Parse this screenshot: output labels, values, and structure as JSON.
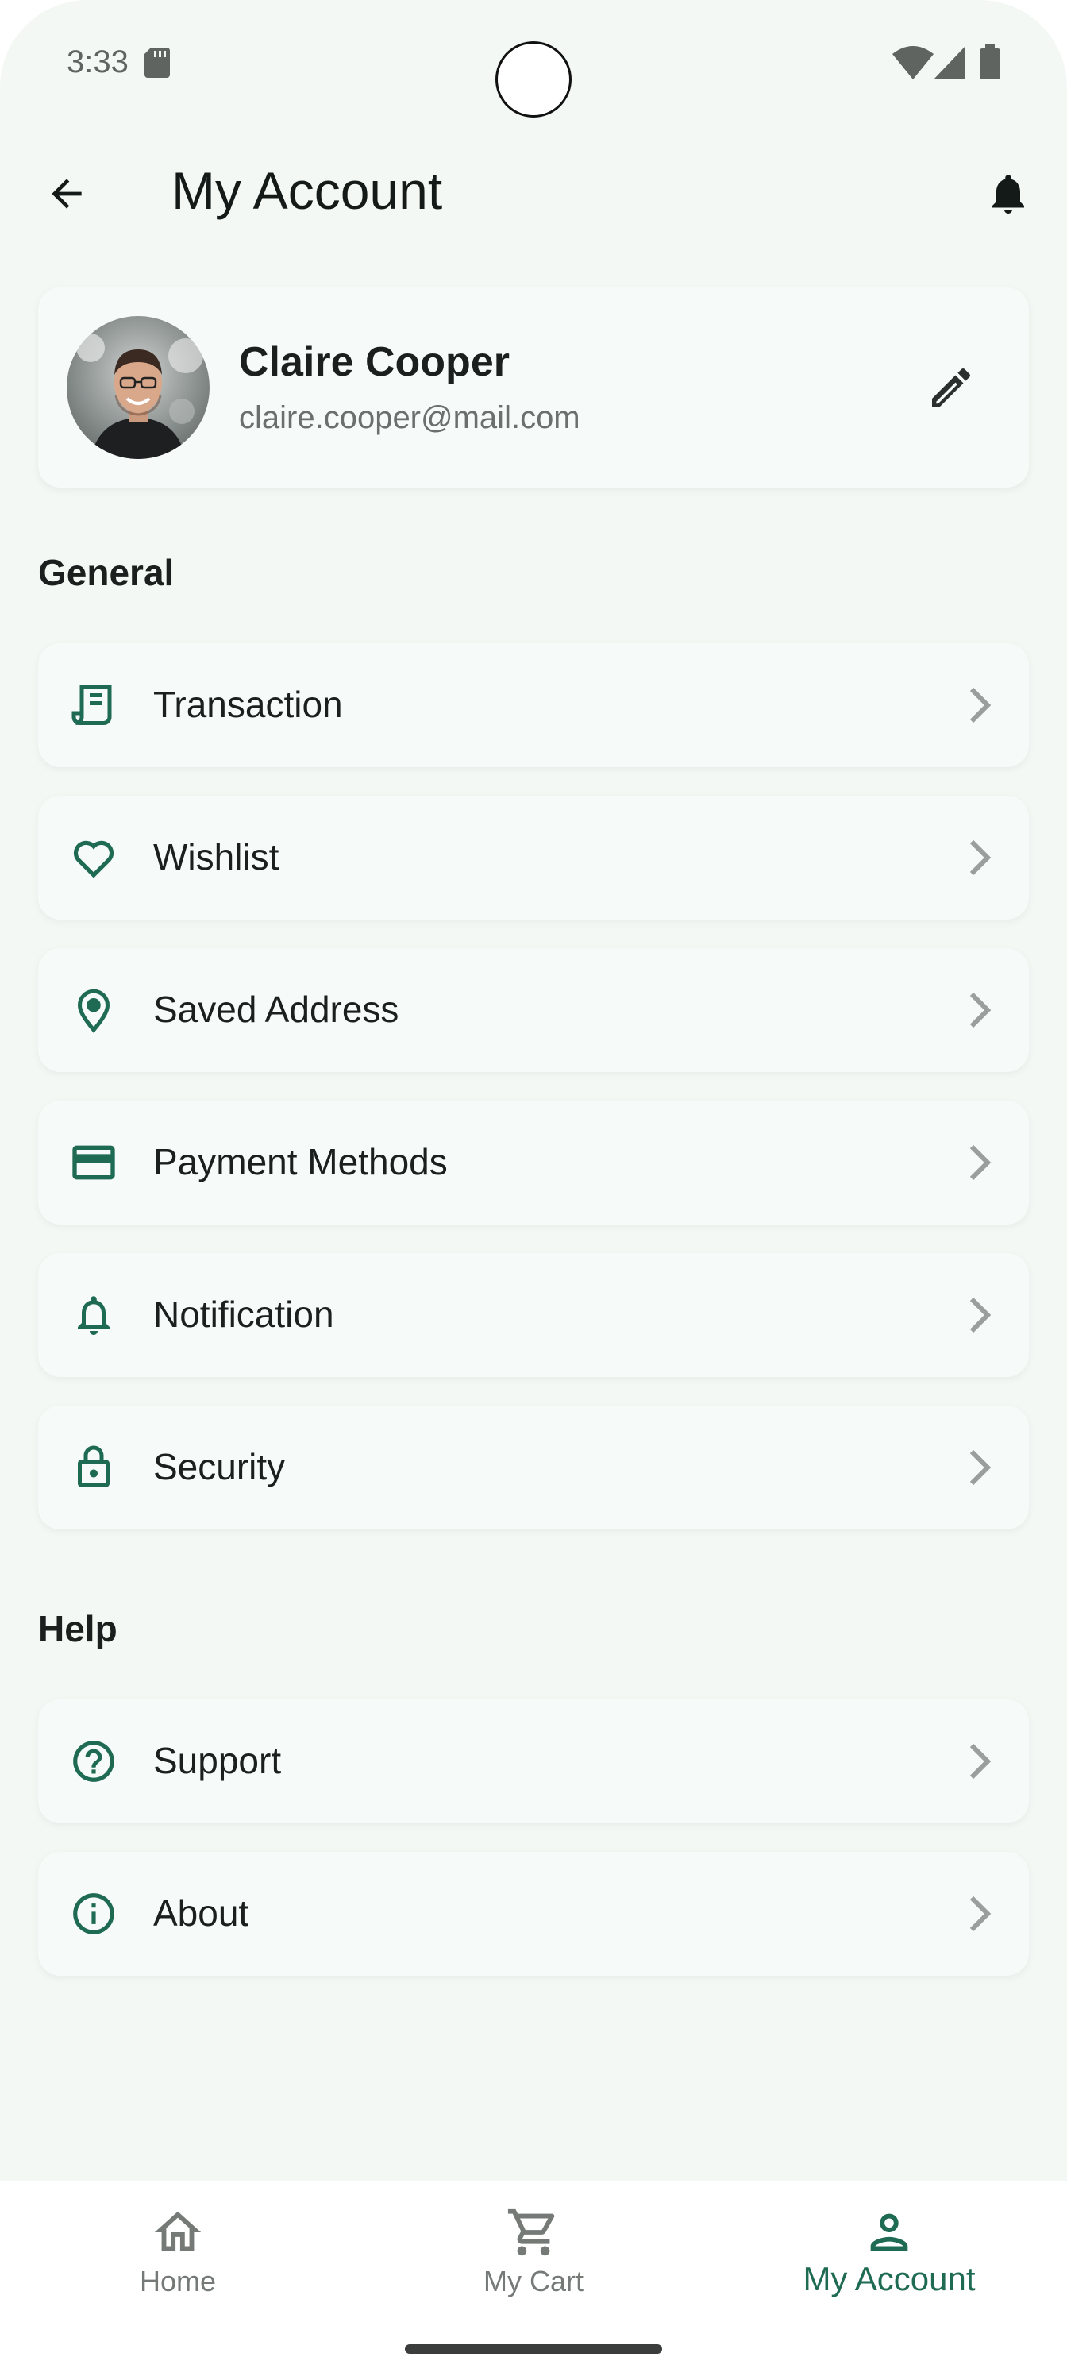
{
  "status_bar": {
    "time": "3:33",
    "icons": [
      "sd-card-icon",
      "wifi-icon",
      "signal-icon",
      "battery-icon"
    ]
  },
  "app_bar": {
    "title": "My Account",
    "left_icon": "arrow-back-icon",
    "right_icon": "bell-icon"
  },
  "profile": {
    "name": "Claire Cooper",
    "email": "claire.cooper@mail.com",
    "edit_icon": "pencil-icon"
  },
  "sections": {
    "general": {
      "title": "General",
      "items": [
        {
          "label": "Transaction",
          "icon": "receipt-icon"
        },
        {
          "label": "Wishlist",
          "icon": "heart-icon"
        },
        {
          "label": "Saved Address",
          "icon": "location-pin-icon"
        },
        {
          "label": "Payment Methods",
          "icon": "credit-card-icon"
        },
        {
          "label": "Notification",
          "icon": "bell-outline-icon"
        },
        {
          "label": "Security",
          "icon": "lock-icon"
        }
      ]
    },
    "help": {
      "title": "Help",
      "items": [
        {
          "label": "Support",
          "icon": "help-circle-icon"
        },
        {
          "label": "About",
          "icon": "info-circle-icon"
        }
      ]
    }
  },
  "bottom_nav": {
    "items": [
      {
        "label": "Home",
        "icon": "home-icon",
        "active": false
      },
      {
        "label": "My Cart",
        "icon": "cart-icon",
        "active": false
      },
      {
        "label": "My Account",
        "icon": "person-icon",
        "active": true
      }
    ]
  },
  "colors": {
    "background": "#f3f8f5",
    "accent": "#1e6a53",
    "text_primary": "#1b1f1d",
    "text_secondary": "#6b6f6d",
    "chevron": "#9a9e9c"
  }
}
